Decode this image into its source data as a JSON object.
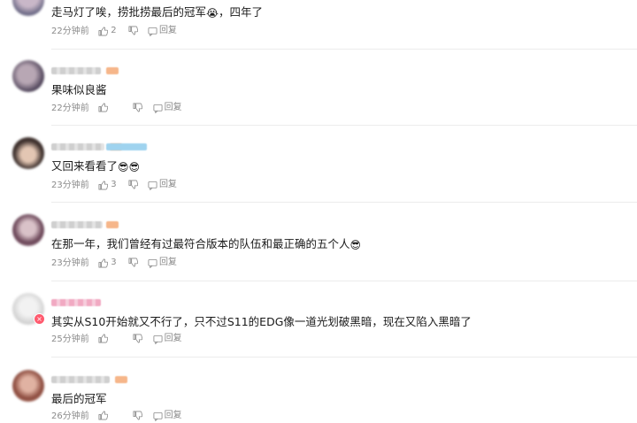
{
  "comments": [
    {
      "text": "走马灯了唉，捞批捞最后的冠军",
      "emoji": "😭",
      "text_after": "，四年了",
      "time": "22分钟前",
      "likes": "2",
      "reply_label": "回复"
    },
    {
      "text": "果味似良酱",
      "emoji": "",
      "text_after": "",
      "time": "22分钟前",
      "likes": "",
      "reply_label": "回复"
    },
    {
      "text": "又回来看看了",
      "emoji": "😎😎",
      "text_after": "",
      "time": "23分钟前",
      "likes": "3",
      "reply_label": "回复"
    },
    {
      "text": "在那一年，我们曾经有过最符合版本的队伍和最正确的五个人",
      "emoji": "😎",
      "text_after": "",
      "time": "23分钟前",
      "likes": "3",
      "reply_label": "回复"
    },
    {
      "text": "其实从S10开始就又不行了，只不过S11的EDG像一道光划破黑暗，现在又陷入黑暗了",
      "emoji": "",
      "text_after": "",
      "time": "25分钟前",
      "likes": "",
      "reply_label": "回复"
    },
    {
      "text": "最后的冠军",
      "emoji": "",
      "text_after": "",
      "time": "26分钟前",
      "likes": "",
      "reply_label": "回复"
    }
  ],
  "icons": {
    "like": "thumb-up-icon",
    "dislike": "thumb-down-icon",
    "reply": "reply-icon"
  },
  "colors": {
    "meta": "#8a8a8a",
    "divider": "#ececec",
    "badge": "#ff5a6e"
  }
}
